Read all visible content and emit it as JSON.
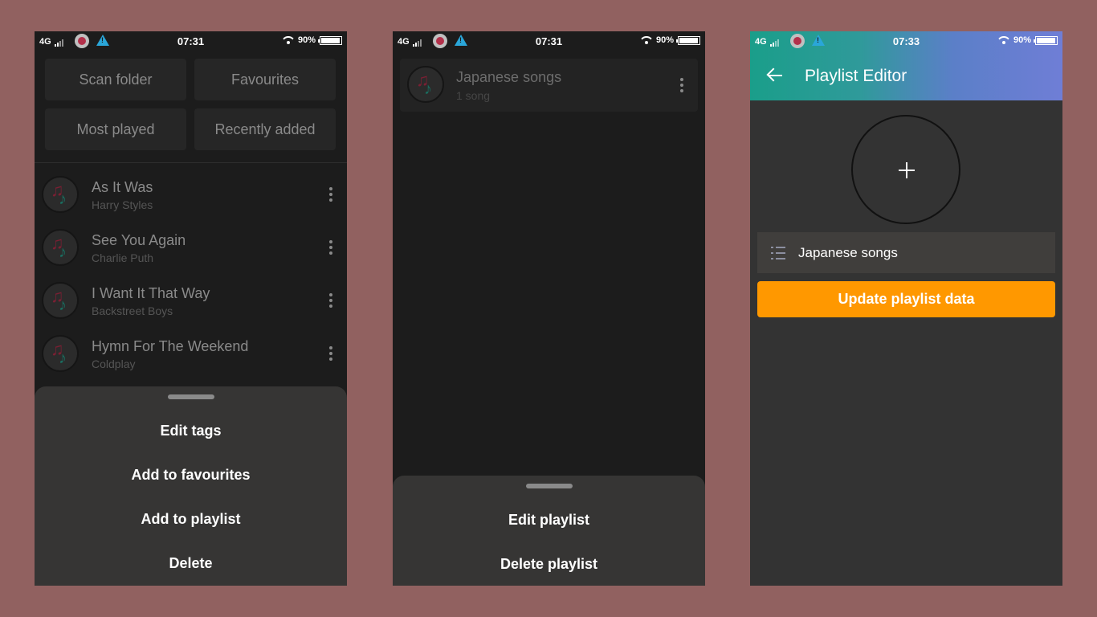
{
  "status_bar": {
    "network": "4G",
    "battery": "90%",
    "battery_level": 0.9
  },
  "screens": [
    {
      "time": "07:31",
      "quick_actions": [
        "Scan folder",
        "Favourites",
        "Most played",
        "Recently added"
      ],
      "songs": [
        {
          "title": "As It Was",
          "artist": "Harry Styles"
        },
        {
          "title": "See You Again",
          "artist": "Charlie Puth"
        },
        {
          "title": "I Want It That Way",
          "artist": "Backstreet Boys"
        },
        {
          "title": "Hymn For The Weekend",
          "artist": "Coldplay"
        }
      ],
      "sheet_items": [
        "Edit tags",
        "Add to favourites",
        "Add to playlist",
        "Delete"
      ]
    },
    {
      "time": "07:31",
      "playlist": {
        "title": "Japanese songs",
        "count": "1 song"
      },
      "sheet_items": [
        "Edit playlist",
        "Delete playlist"
      ]
    },
    {
      "time": "07:33",
      "app_bar_title": "Playlist Editor",
      "playlist_name": "Japanese songs",
      "update_button": "Update playlist data"
    }
  ],
  "colors": {
    "background": "#916160",
    "accent": "#ff9800",
    "appbar_start": "#1a9e8a",
    "appbar_end": "#6f7ed6"
  }
}
